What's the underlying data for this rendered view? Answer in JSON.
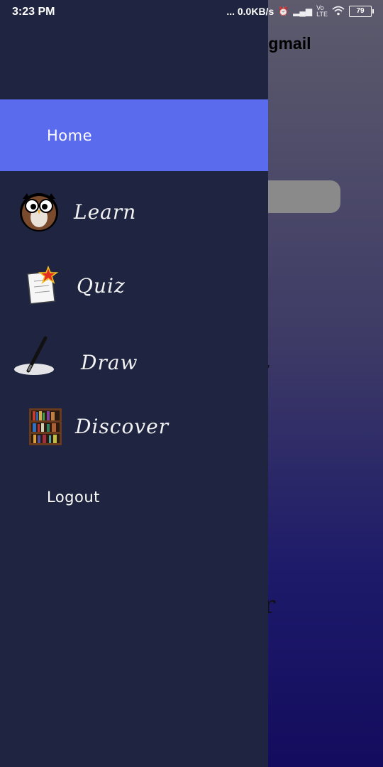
{
  "status_bar": {
    "time": "3:23 PM",
    "network_speed": "... 0.0KB/s",
    "battery_level": "79"
  },
  "background": {
    "email_text": "@gmail"
  },
  "drawer": {
    "items": [
      {
        "label": "Home",
        "icon": "none",
        "selected": true
      },
      {
        "label": "Learn",
        "icon": "owl-icon"
      },
      {
        "label": "Quiz",
        "icon": "quiz-paper-icon"
      },
      {
        "label": "Draw",
        "icon": "pen-icon"
      },
      {
        "label": "Discover",
        "icon": "bookshelf-icon"
      },
      {
        "label": "Logout",
        "icon": "none"
      }
    ],
    "colors": {
      "drawer_bg": "#1f2540",
      "selected_bg": "#5b6bee"
    }
  }
}
